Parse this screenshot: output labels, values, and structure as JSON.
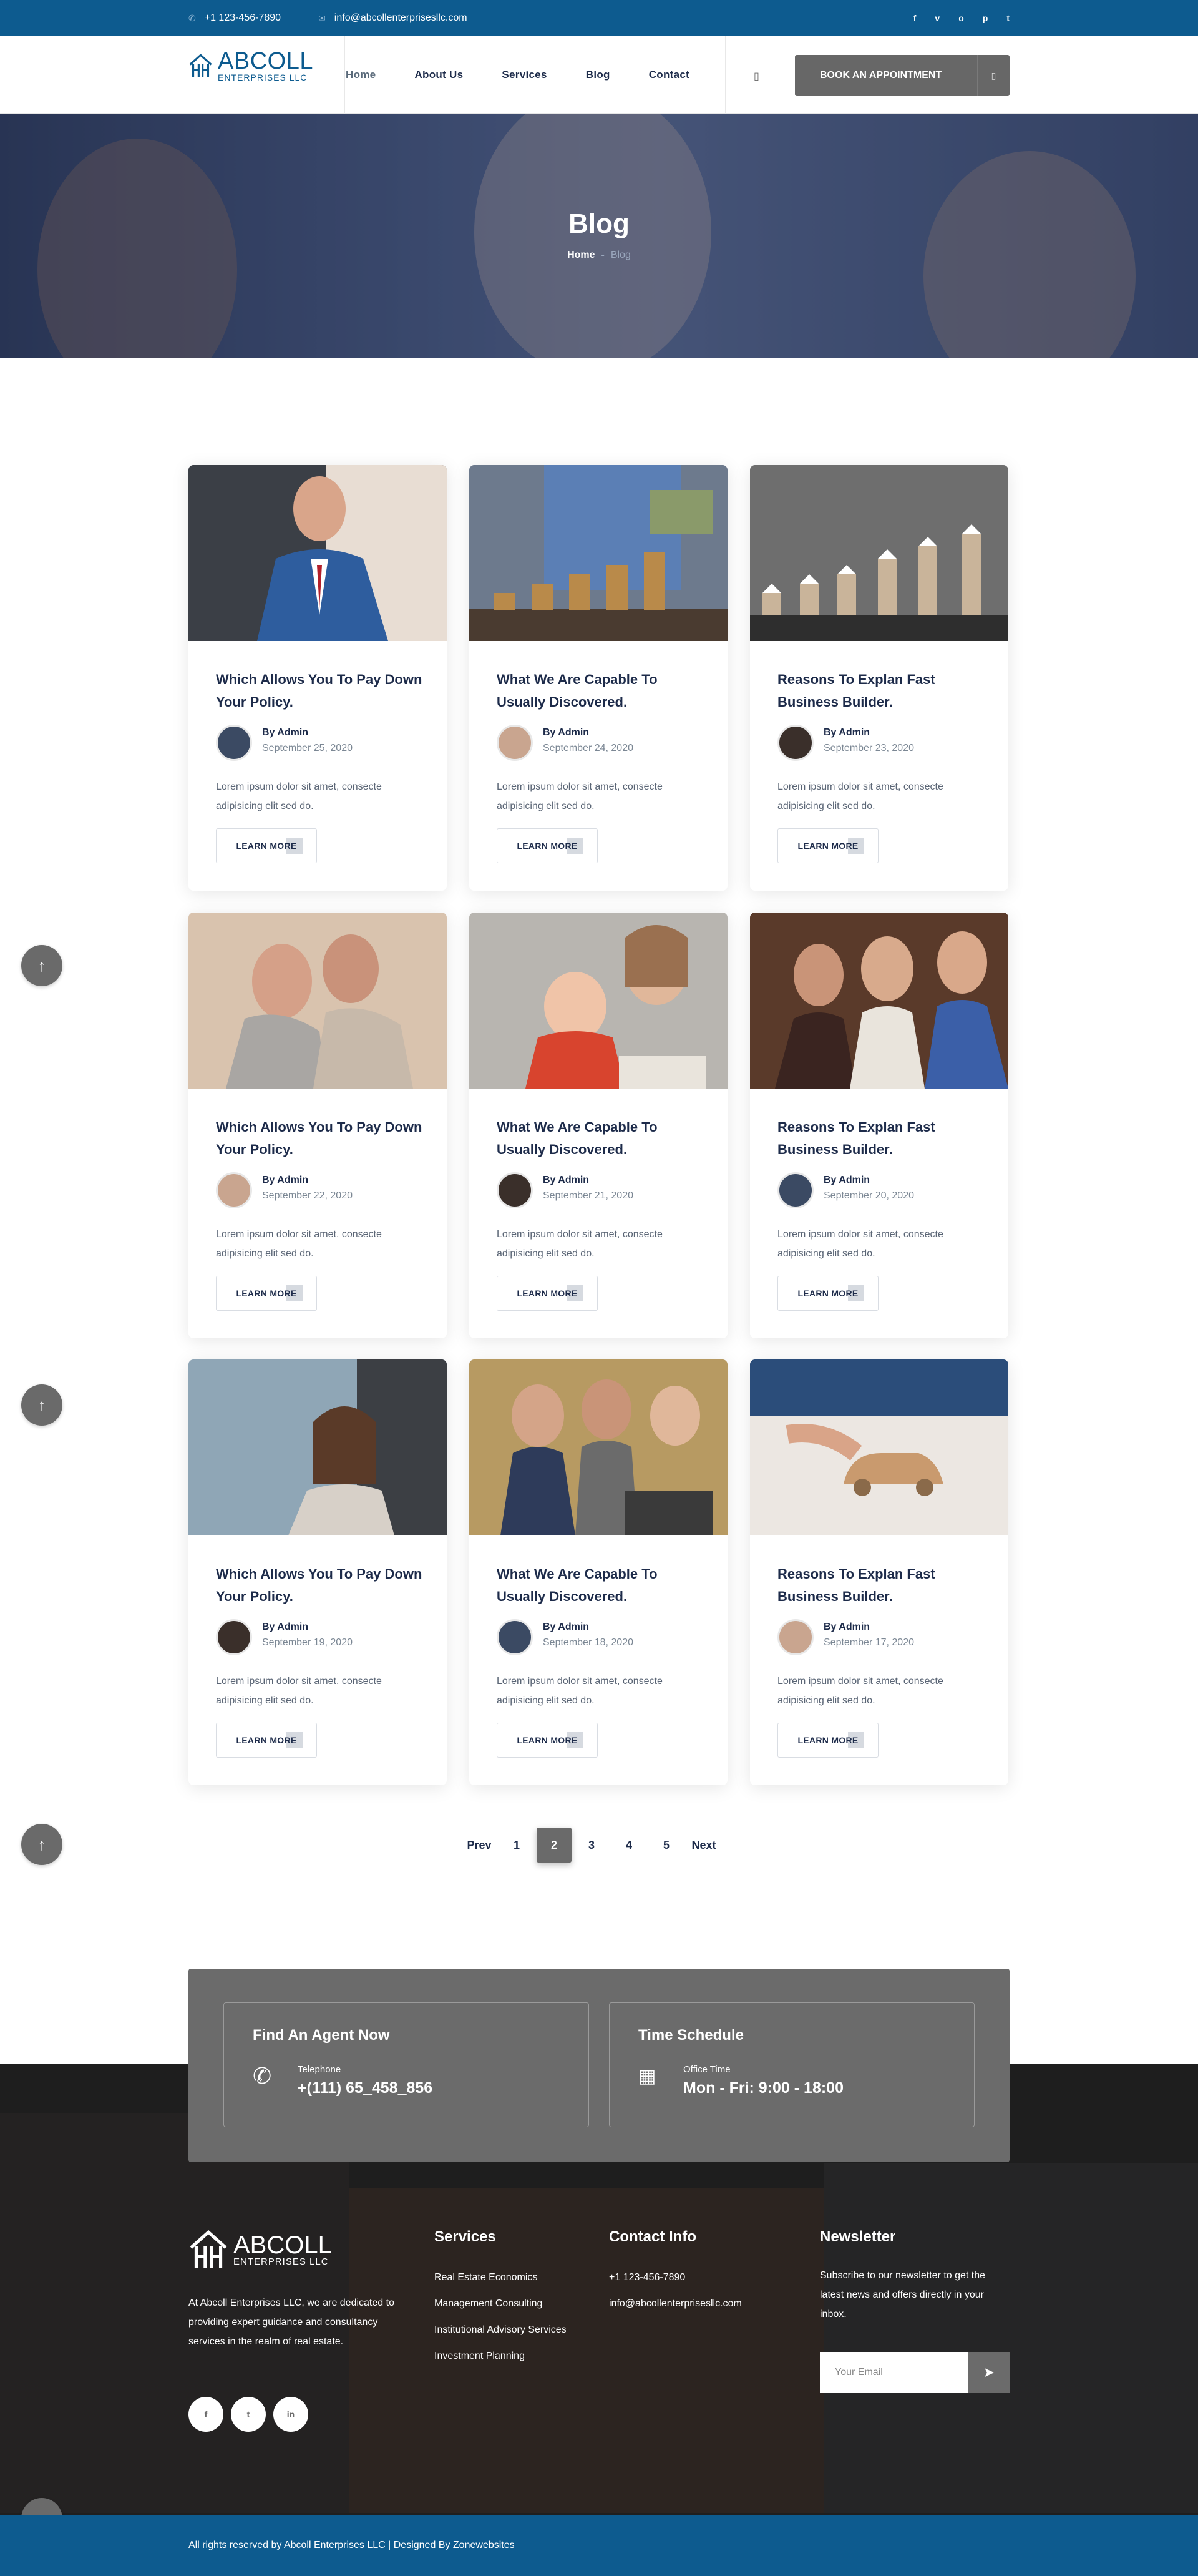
{
  "topbar": {
    "phone": "+1 123-456-7890",
    "email": "info@abcollenterprisesllc.com",
    "socials": [
      "f",
      "v",
      "o",
      "p",
      "t"
    ],
    "phone_icon": "phone-icon",
    "email_icon": "envelope-icon"
  },
  "brand": {
    "name": "ABCOLL",
    "sub": "ENTERPRISES LLC"
  },
  "nav": [
    "Home",
    "About Us",
    "Services",
    "Blog",
    "Contact"
  ],
  "header": {
    "search_icon": "▯",
    "book_label": "BOOK AN APPOINTMENT",
    "book_icon": "▯"
  },
  "hero": {
    "title": "Blog",
    "crumb_home": "Home",
    "crumb_sep": "-",
    "crumb_current": "Blog"
  },
  "posts": [
    {
      "title": "Which Allows You To Pay Down Your Policy.",
      "author": "By Admin",
      "date": "September 25, 2020",
      "excerpt": "Lorem ipsum dolor sit amet, consecte adipisicing elit sed do.",
      "more": "LEARN MORE"
    },
    {
      "title": "What We Are Capable To Usually Discovered.",
      "author": "By Admin",
      "date": "September 24, 2020",
      "excerpt": "Lorem ipsum dolor sit amet, consecte adipisicing elit sed do.",
      "more": "LEARN MORE"
    },
    {
      "title": "Reasons To Explan Fast Business Builder.",
      "author": "By Admin",
      "date": "September 23, 2020",
      "excerpt": "Lorem ipsum dolor sit amet, consecte adipisicing elit sed do.",
      "more": "LEARN MORE"
    },
    {
      "title": "Which Allows You To Pay Down Your Policy.",
      "author": "By Admin",
      "date": "September 22, 2020",
      "excerpt": "Lorem ipsum dolor sit amet, consecte adipisicing elit sed do.",
      "more": "LEARN MORE"
    },
    {
      "title": "What We Are Capable To Usually Discovered.",
      "author": "By Admin",
      "date": "September 21, 2020",
      "excerpt": "Lorem ipsum dolor sit amet, consecte adipisicing elit sed do.",
      "more": "LEARN MORE"
    },
    {
      "title": "Reasons To Explan Fast Business Builder.",
      "author": "By Admin",
      "date": "September 20, 2020",
      "excerpt": "Lorem ipsum dolor sit amet, consecte adipisicing elit sed do.",
      "more": "LEARN MORE"
    },
    {
      "title": "Which Allows You To Pay Down Your Policy.",
      "author": "By Admin",
      "date": "September 19, 2020",
      "excerpt": "Lorem ipsum dolor sit amet, consecte adipisicing elit sed do.",
      "more": "LEARN MORE"
    },
    {
      "title": "What We Are Capable To Usually Discovered.",
      "author": "By Admin",
      "date": "September 18, 2020",
      "excerpt": "Lorem ipsum dolor sit amet, consecte adipisicing elit sed do.",
      "more": "LEARN MORE"
    },
    {
      "title": "Reasons To Explan Fast Business Builder.",
      "author": "By Admin",
      "date": "September 17, 2020",
      "excerpt": "Lorem ipsum dolor sit amet, consecte adipisicing elit sed do.",
      "more": "LEARN MORE"
    }
  ],
  "pagination": {
    "prev": "Prev",
    "pages": [
      "1",
      "2",
      "3",
      "4",
      "5"
    ],
    "active": "2",
    "next": "Next"
  },
  "cta": {
    "agent": {
      "title": "Find An Agent Now",
      "label": "Telephone",
      "value": "+(111) 65_458_856",
      "icon": "phone-icon"
    },
    "schedule": {
      "title": "Time Schedule",
      "label": "Office Time",
      "value": "Mon - Fri: 9:00 - 18:00",
      "icon": "calendar-icon"
    }
  },
  "footer": {
    "about": "At Abcoll Enterprises LLC, we are dedicated to providing expert guidance and consultancy services in the realm of real estate.",
    "socials": [
      "f",
      "t",
      "in"
    ],
    "services_title": "Services",
    "services": [
      "Real Estate Economics",
      "Management Consulting",
      "Institutional Advisory Services",
      "Investment Planning"
    ],
    "contact_title": "Contact Info",
    "contact": [
      "+1 123-456-7890",
      "info@abcollenterprisesllc.com"
    ],
    "newsletter_title": "Newsletter",
    "newsletter_text": "Subscribe to our newsletter to get the latest news and offers directly in your inbox.",
    "email_placeholder": "Your Email",
    "copyright": "All rights reserved by Abcoll Enterprises LLC | Designed By Zonewebsites"
  },
  "scroll_top_icon": "arrow-up-icon",
  "colors": {
    "brand_blue": "#0d5b8f",
    "gray_button": "#6a6a6a",
    "heading": "#1d2b4a"
  }
}
